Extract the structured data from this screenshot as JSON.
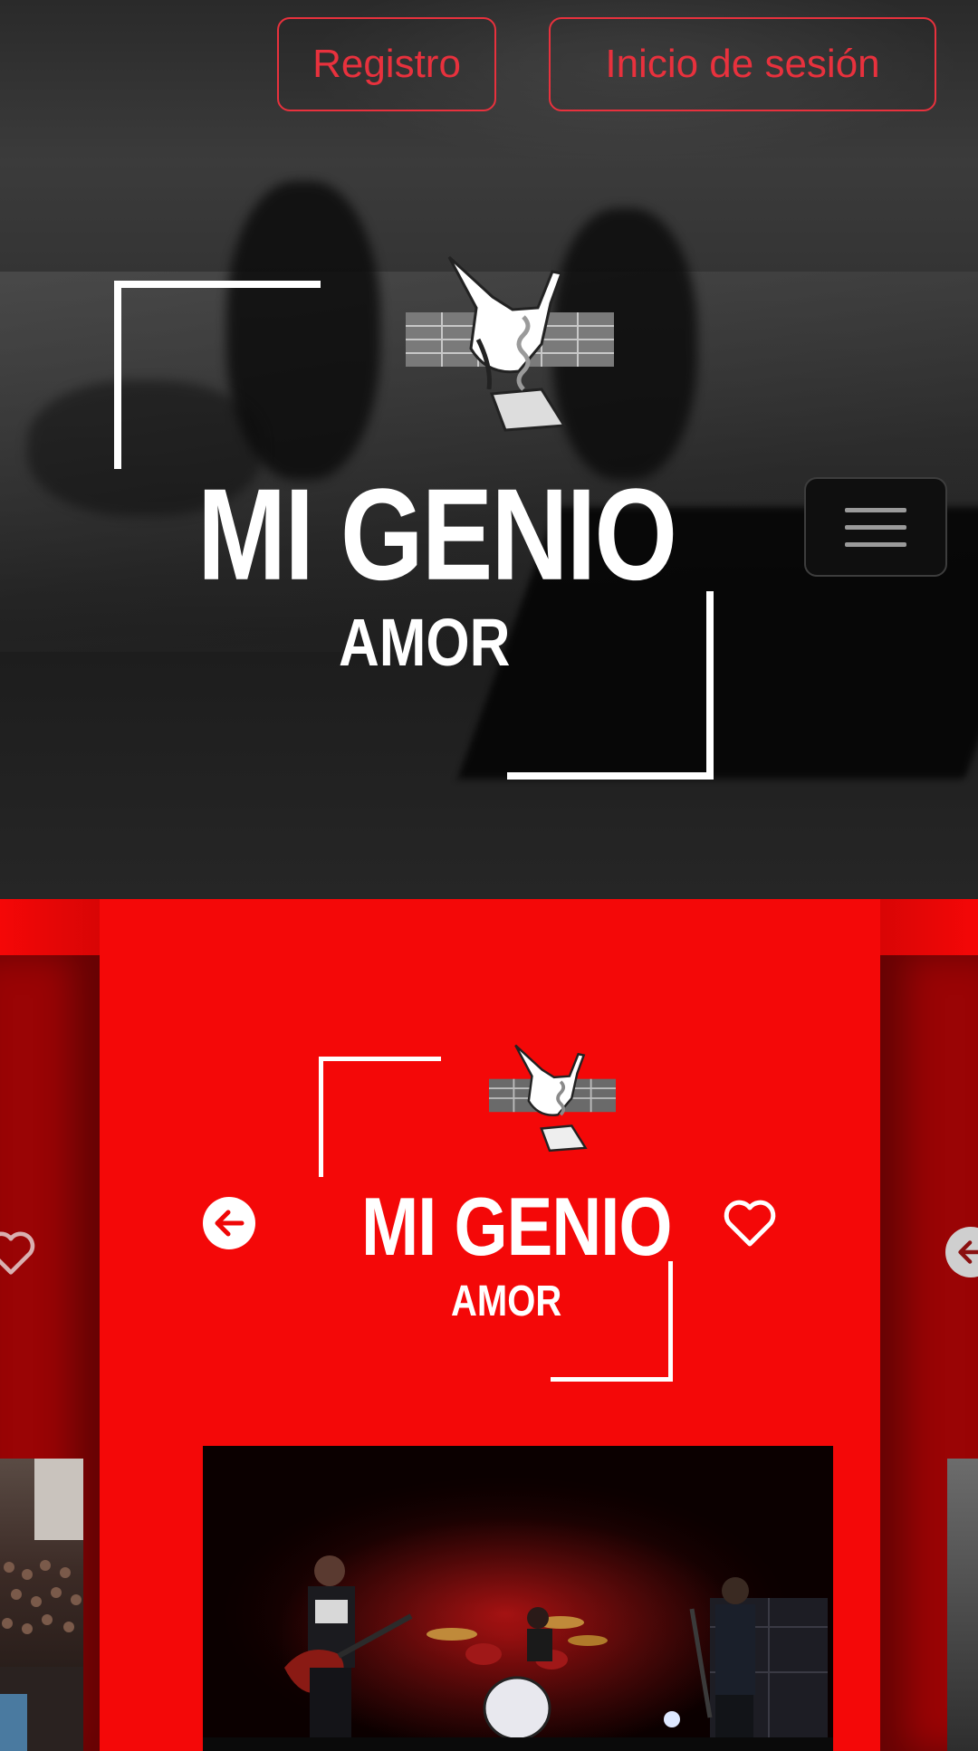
{
  "header": {
    "register_label": "Registro",
    "login_label": "Inicio de sesión"
  },
  "brand": {
    "title": "MI GENIO",
    "subtitle": "AMOR"
  },
  "menu": {
    "icon": "hamburger-menu-icon"
  },
  "carousel": {
    "prev_icon": "arrow-left-icon",
    "favorite_icon": "heart-icon"
  },
  "colors": {
    "accent_red": "#e8313d",
    "carousel_red": "#f40808",
    "side_panel_red": "#9a0405"
  }
}
